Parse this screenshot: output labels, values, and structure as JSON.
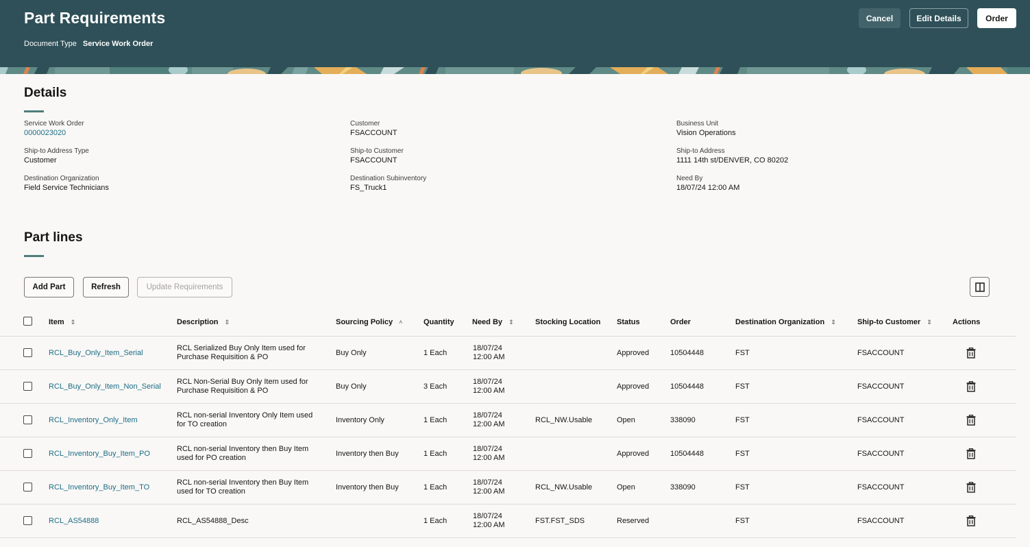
{
  "header": {
    "title": "Part Requirements",
    "document_type_label": "Document Type",
    "document_type_value": "Service Work Order",
    "buttons": {
      "cancel": "Cancel",
      "edit_details": "Edit Details",
      "order": "Order"
    },
    "colors": {
      "background": "#2f5058"
    }
  },
  "details": {
    "title": "Details",
    "fields": [
      {
        "label": "Service Work Order",
        "value": "0000023020",
        "link": true
      },
      {
        "label": "Customer",
        "value": "FSACCOUNT"
      },
      {
        "label": "Business Unit",
        "value": "Vision Operations"
      },
      {
        "label": "Ship-to Address Type",
        "value": "Customer"
      },
      {
        "label": "Ship-to Customer",
        "value": "FSACCOUNT"
      },
      {
        "label": "Ship-to Address",
        "value": "1111 14th st/DENVER, CO 80202"
      },
      {
        "label": "Destination Organization",
        "value": "Field Service Technicians"
      },
      {
        "label": "Destination Subinventory",
        "value": "FS_Truck1"
      },
      {
        "label": "Need By",
        "value": "18/07/24 12:00 AM"
      }
    ]
  },
  "part_lines": {
    "title": "Part lines",
    "toolbar": {
      "add_part": "Add Part",
      "refresh": "Refresh",
      "update_requirements": "Update Requirements",
      "columns_icon": "panel-columns-icon"
    },
    "columns": [
      {
        "label": "Item",
        "sort": "unsorted"
      },
      {
        "label": "Description",
        "sort": "unsorted"
      },
      {
        "label": "Sourcing Policy",
        "sort": "ascending"
      },
      {
        "label": "Quantity"
      },
      {
        "label": "Need By",
        "sort": "unsorted"
      },
      {
        "label": "Stocking Location"
      },
      {
        "label": "Status"
      },
      {
        "label": "Order"
      },
      {
        "label": "Destination Organization",
        "sort": "unsorted"
      },
      {
        "label": "Ship-to Customer",
        "sort": "unsorted"
      },
      {
        "label": "Actions"
      }
    ],
    "rows": [
      {
        "item": "RCL_Buy_Only_Item_Serial",
        "desc1": "RCL Serialized Buy Only Item used for",
        "desc2": "Purchase Requisition & PO",
        "policy": "Buy Only",
        "quantity": "1 Each",
        "need_date": "18/07/24",
        "need_time": "12:00 AM",
        "location": "",
        "status": "Approved",
        "order": "10504448",
        "dest_org": "FST",
        "ship_to": "FSACCOUNT",
        "action_icon": "trash-icon"
      },
      {
        "item": "RCL_Buy_Only_Item_Non_Serial",
        "desc1": "RCL Non-Serial Buy Only Item used for",
        "desc2": "Purchase Requisition & PO",
        "policy": "Buy Only",
        "quantity": "3 Each",
        "need_date": "18/07/24",
        "need_time": "12:00 AM",
        "location": "",
        "status": "Approved",
        "order": "10504448",
        "dest_org": "FST",
        "ship_to": "FSACCOUNT",
        "action_icon": "trash-icon"
      },
      {
        "item": "RCL_Inventory_Only_Item",
        "desc1": "RCL non-serial Inventory Only Item used",
        "desc2": "for TO creation",
        "policy": "Inventory Only",
        "quantity": "1 Each",
        "need_date": "18/07/24",
        "need_time": "12:00 AM",
        "location": "RCL_NW.Usable",
        "status": "Open",
        "order": "338090",
        "dest_org": "FST",
        "ship_to": "FSACCOUNT",
        "action_icon": "trash-icon"
      },
      {
        "item": "RCL_Inventory_Buy_Item_PO",
        "desc1": "RCL non-serial Inventory then Buy Item",
        "desc2": "used for PO creation",
        "policy": "Inventory then Buy",
        "quantity": "1 Each",
        "need_date": "18/07/24",
        "need_time": "12:00 AM",
        "location": "",
        "status": "Approved",
        "order": "10504448",
        "dest_org": "FST",
        "ship_to": "FSACCOUNT",
        "action_icon": "trash-icon"
      },
      {
        "item": "RCL_Inventory_Buy_Item_TO",
        "desc1": "RCL non-serial Inventory then Buy Item",
        "desc2": "used for TO creation",
        "policy": "Inventory then Buy",
        "quantity": "1 Each",
        "need_date": "18/07/24",
        "need_time": "12:00 AM",
        "location": "RCL_NW.Usable",
        "status": "Open",
        "order": "338090",
        "dest_org": "FST",
        "ship_to": "FSACCOUNT",
        "action_icon": "trash-icon"
      },
      {
        "item": "RCL_AS54888",
        "desc1": "RCL_AS54888_Desc",
        "desc2": "",
        "policy": "",
        "quantity": "1 Each",
        "need_date": "18/07/24",
        "need_time": "12:00 AM",
        "location": "FST.FST_SDS",
        "status": "Reserved",
        "order": "",
        "dest_org": "FST",
        "ship_to": "FSACCOUNT",
        "action_icon": "trash-icon"
      }
    ]
  },
  "colors": {
    "link": "#1b6c86",
    "accent_bar": "#4f7d7b"
  }
}
